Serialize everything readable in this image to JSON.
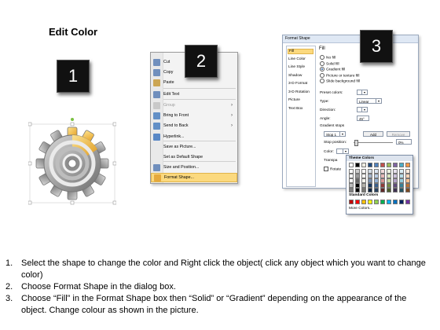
{
  "title": "Edit Color",
  "steps_numbers": [
    "1",
    "2",
    "3"
  ],
  "context_menu": {
    "items": [
      {
        "label": "Cut",
        "icon": "scissors-icon",
        "disabled": false,
        "submenu": false
      },
      {
        "label": "Copy",
        "icon": "copy-icon",
        "disabled": false,
        "submenu": false
      },
      {
        "label": "Paste",
        "icon": "paste-icon",
        "disabled": false,
        "submenu": false
      },
      {
        "label": "Edit Text",
        "icon": "edit-text-icon",
        "disabled": false,
        "submenu": false
      },
      {
        "label": "Group",
        "icon": "group-icon",
        "disabled": true,
        "submenu": true
      },
      {
        "label": "Bring to Front",
        "icon": "bring-front-icon",
        "disabled": false,
        "submenu": true
      },
      {
        "label": "Send to Back",
        "icon": "send-back-icon",
        "disabled": false,
        "submenu": true
      },
      {
        "label": "Hyperlink...",
        "icon": "hyperlink-icon",
        "disabled": false,
        "submenu": false
      },
      {
        "label": "Save as Picture...",
        "icon": "",
        "disabled": false,
        "submenu": false
      },
      {
        "label": "Set as Default Shape",
        "icon": "",
        "disabled": false,
        "submenu": false
      },
      {
        "label": "Size and Position...",
        "icon": "size-position-icon",
        "disabled": false,
        "submenu": false
      },
      {
        "label": "Format Shape...",
        "icon": "format-shape-icon",
        "disabled": false,
        "submenu": false,
        "selected": true
      }
    ]
  },
  "format_shape": {
    "window_title": "Format Shape",
    "nav": [
      "Fill",
      "Line Color",
      "Line Style",
      "Shadow",
      "3-D Format",
      "3-D Rotation",
      "Picture",
      "Text Box"
    ],
    "pane_title": "Fill",
    "options": [
      "No fill",
      "Solid fill",
      "Gradient fill",
      "Picture or texture fill",
      "Slide background fill"
    ],
    "selected_option": "Gradient fill",
    "preset_colors_label": "Preset colors:",
    "type_label": "Type:",
    "type_value": "Linear",
    "direction_label": "Direction:",
    "angle_label": "Angle:",
    "angle_value": "45°",
    "gradient_stops_label": "Gradient stops",
    "stop_value": "Stop 1",
    "add_label": "Add",
    "remove_label": "Remove",
    "stop_position_label": "Stop position:",
    "stop_position_value": "0%",
    "color_label": "Color:",
    "transparency_label": "Transpa",
    "rotate_label": "Rotate"
  },
  "palette": {
    "theme_header": "Theme Colors",
    "standard_header": "Standard Colors",
    "more_colors": "More Colors...",
    "theme_top_row": [
      "#ffffff",
      "#000000",
      "#eeece1",
      "#1f497d",
      "#4f81bd",
      "#c0504d",
      "#9bbb59",
      "#8064a2",
      "#4bacc6",
      "#f79646"
    ],
    "standard_row": [
      "#c00000",
      "#ff0000",
      "#ffc000",
      "#ffff00",
      "#92d050",
      "#00b050",
      "#00b0f0",
      "#0070c0",
      "#002060",
      "#7030a0"
    ]
  },
  "instructions": [
    {
      "num": "1.",
      "text": "Select the shape to change the color and Right click the object( click any object which you want to change color)"
    },
    {
      "num": "2.",
      "text": "Choose Format Shape in the dialog box."
    },
    {
      "num": "3.",
      "text": "Choose “Fill” in the Format Shape box then “Solid” or “Gradient” depending on the appearance of the object. Change colour as shown in the picture."
    }
  ],
  "colors": {
    "gear_gray": "#9a9a9a",
    "gear_highlight": "#f2b53a",
    "menu_selected": "#fbd97e"
  }
}
